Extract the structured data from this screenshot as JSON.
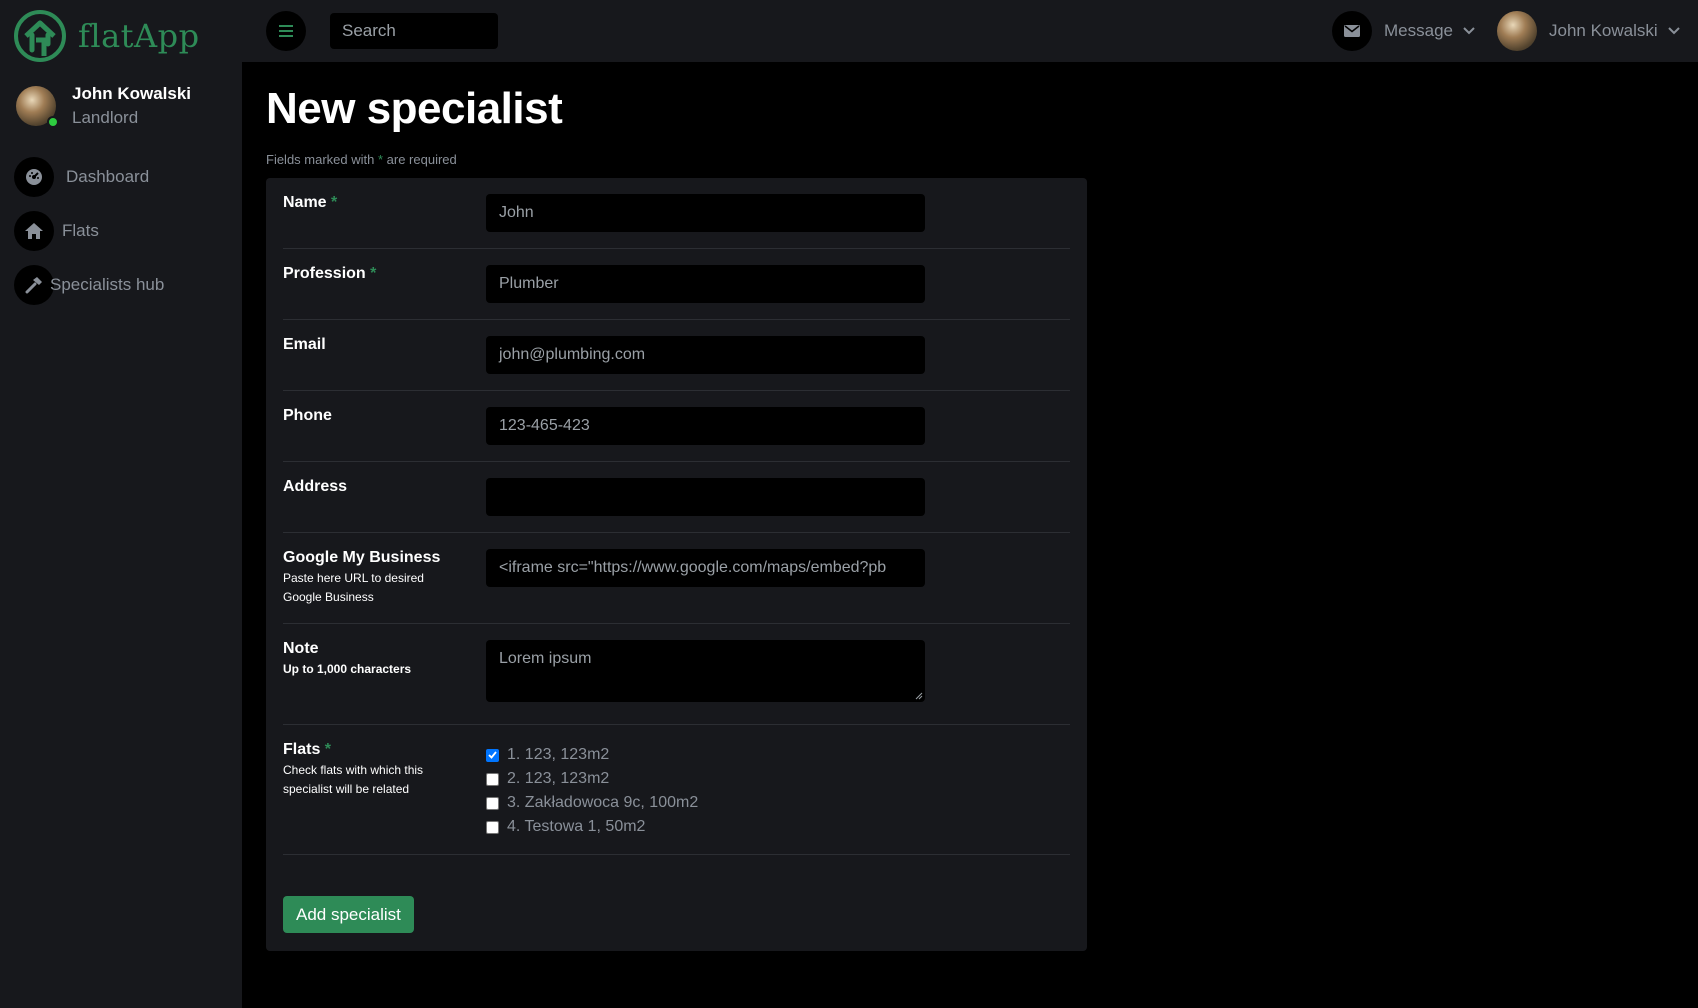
{
  "app": {
    "name": "flatApp"
  },
  "user": {
    "name": "John Kowalski",
    "role": "Landlord"
  },
  "sidebar": {
    "items": [
      {
        "label": "Dashboard",
        "icon": "dashboard-icon"
      },
      {
        "label": "Flats",
        "icon": "home-icon"
      },
      {
        "label": "Specialists hub",
        "icon": "hammer-icon"
      }
    ]
  },
  "topbar": {
    "search_placeholder": "Search",
    "message_label": "Message",
    "profile_name": "John Kowalski"
  },
  "page": {
    "title": "New specialist",
    "required_note_prefix": "Fields marked with ",
    "required_star": "*",
    "required_note_suffix": " are required"
  },
  "form": {
    "name": {
      "label": "Name",
      "value": "John"
    },
    "profession": {
      "label": "Profession",
      "value": "Plumber"
    },
    "email": {
      "label": "Email",
      "value": "john@plumbing.com"
    },
    "phone": {
      "label": "Phone",
      "value": "123-465-423"
    },
    "address": {
      "label": "Address",
      "value": ""
    },
    "google": {
      "label": "Google My Business",
      "hint_line1": "Paste here URL to desired",
      "hint_line2": "Google Business",
      "value": "<iframe src=\"https://www.google.com/maps/embed?pb"
    },
    "note": {
      "label": "Note",
      "hint": "Up to 1,000 characters",
      "placeholder": "Lorem ipsum"
    },
    "flats": {
      "label": "Flats",
      "hint_line1": "Check flats with which this",
      "hint_line2": "specialist will be related",
      "options": [
        {
          "label": "1. 123, 123m2",
          "checked": true
        },
        {
          "label": "2. 123, 123m2",
          "checked": false
        },
        {
          "label": "3. Zakładowoca 9c, 100m2",
          "checked": false
        },
        {
          "label": "4. Testowa 1, 50m2",
          "checked": false
        }
      ]
    },
    "submit_label": "Add specialist"
  },
  "colors": {
    "accent": "#2e8b57",
    "bg": "#000000",
    "panel": "#17181c",
    "muted": "#8a9099",
    "checkbox": "#0075ff"
  }
}
